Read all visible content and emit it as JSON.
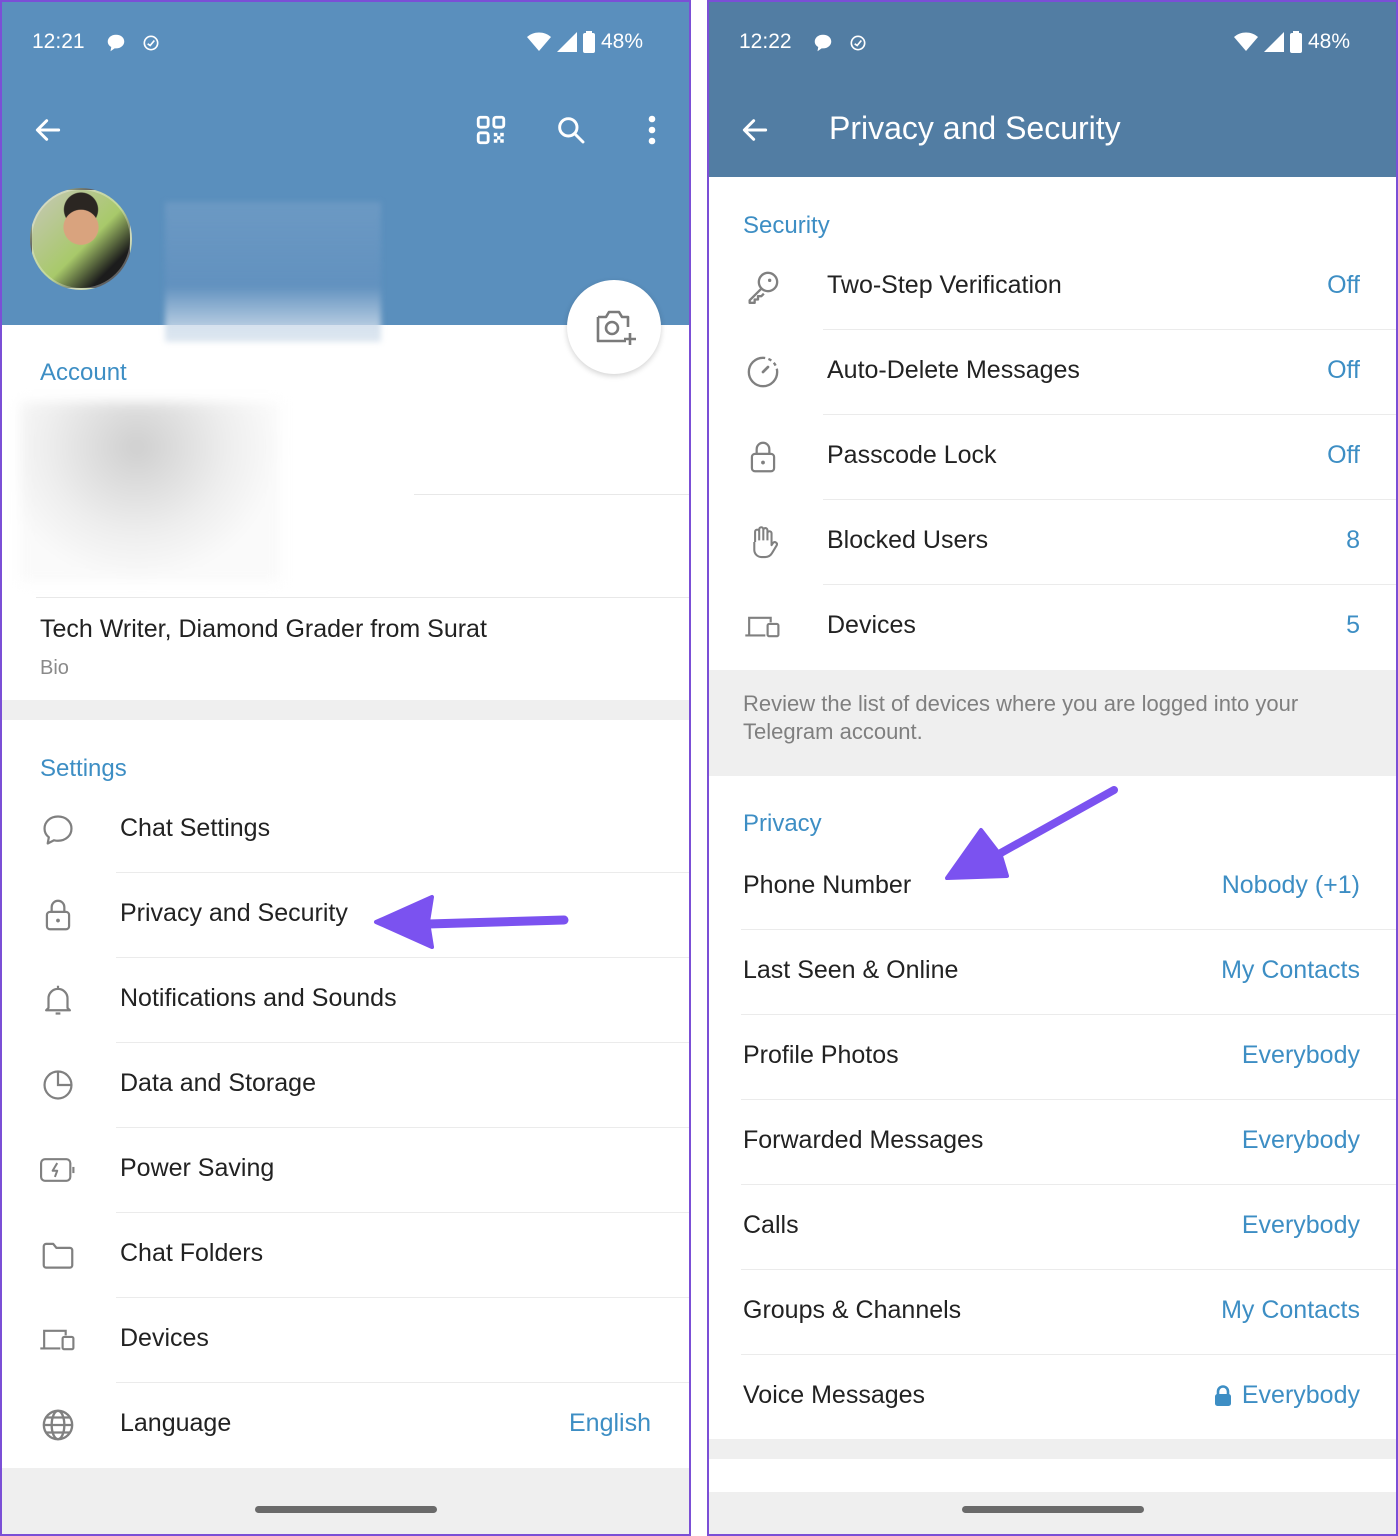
{
  "left_screen": {
    "status_bar": {
      "time": "12:21",
      "battery": "48%"
    },
    "toolbar": {
      "back_icon": "arrow-left-icon",
      "qr_icon": "qr-code-icon",
      "search_icon": "search-icon",
      "menu_icon": "more-vertical-icon"
    },
    "profile": {
      "avatar": "profile-photo",
      "camera_icon": "add-photo-icon"
    },
    "account_section": {
      "title": "Account",
      "bio_value": "Tech Writer, Diamond Grader from Surat",
      "bio_label": "Bio"
    },
    "settings_section": {
      "title": "Settings",
      "items": [
        {
          "label": "Chat Settings",
          "icon": "chat-bubble-icon"
        },
        {
          "label": "Privacy and Security",
          "icon": "lock-icon"
        },
        {
          "label": "Notifications and Sounds",
          "icon": "bell-icon"
        },
        {
          "label": "Data and Storage",
          "icon": "pie-chart-icon"
        },
        {
          "label": "Power Saving",
          "icon": "battery-bolt-icon"
        },
        {
          "label": "Chat Folders",
          "icon": "folder-icon"
        },
        {
          "label": "Devices",
          "icon": "devices-icon"
        },
        {
          "label": "Language",
          "icon": "globe-icon",
          "value": "English"
        }
      ]
    }
  },
  "right_screen": {
    "status_bar": {
      "time": "12:22",
      "battery": "48%"
    },
    "header": {
      "title": "Privacy and Security",
      "back_icon": "arrow-left-icon"
    },
    "security_section": {
      "title": "Security",
      "items": [
        {
          "label": "Two-Step Verification",
          "value": "Off",
          "icon": "key-icon"
        },
        {
          "label": "Auto-Delete Messages",
          "value": "Off",
          "icon": "timer-icon"
        },
        {
          "label": "Passcode Lock",
          "value": "Off",
          "icon": "lock-icon"
        },
        {
          "label": "Blocked Users",
          "value": "8",
          "icon": "hand-stop-icon"
        },
        {
          "label": "Devices",
          "value": "5",
          "icon": "devices-icon"
        }
      ],
      "info": "Review the list of devices where you are logged into your Telegram account."
    },
    "privacy_section": {
      "title": "Privacy",
      "items": [
        {
          "label": "Phone Number",
          "value": "Nobody (+1)"
        },
        {
          "label": "Last Seen & Online",
          "value": "My Contacts"
        },
        {
          "label": "Profile Photos",
          "value": "Everybody"
        },
        {
          "label": "Forwarded Messages",
          "value": "Everybody"
        },
        {
          "label": "Calls",
          "value": "Everybody"
        },
        {
          "label": "Groups & Channels",
          "value": "My Contacts"
        },
        {
          "label": "Voice Messages",
          "value": "Everybody",
          "locked": true
        }
      ]
    }
  },
  "annotations": {
    "arrow_color": "#7b52f0"
  },
  "colors": {
    "accent": "#3d8ec4",
    "left_header": "#5a8fbd",
    "right_header": "#527da3",
    "panel_border": "#7b4fd6"
  }
}
